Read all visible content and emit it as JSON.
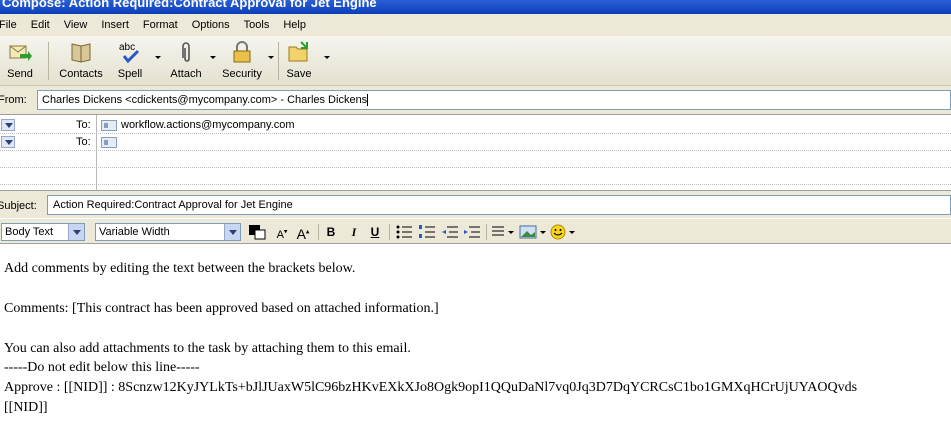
{
  "window": {
    "title": "Compose: Action Required:Contract Approval for Jet Engine"
  },
  "menu": [
    "File",
    "Edit",
    "View",
    "Insert",
    "Format",
    "Options",
    "Tools",
    "Help"
  ],
  "toolbar": {
    "send": "Send",
    "contacts": "Contacts",
    "spell": "Spell",
    "spell_icon_text": "abc",
    "attach": "Attach",
    "security": "Security",
    "save": "Save"
  },
  "header": {
    "from_label": "From:",
    "from_value": "Charles Dickens <cdickents@mycompany.com>  - Charles Dickens",
    "to_label": "To:",
    "recipients": [
      "workflow.actions@mycompany.com",
      ""
    ],
    "subject_label": "Subject:",
    "subject_value": "Action Required:Contract Approval for Jet Engine"
  },
  "format": {
    "paragraph_style": "Body Text",
    "font": "Variable Width",
    "bold": "B",
    "italic": "I",
    "underline": "U",
    "text_color": "#000000"
  },
  "body": {
    "line1": "Add comments by editing the text between the brackets below.",
    "line2": "Comments: [This contract has been approved based on attached information.]",
    "line3": "You can also add attachments to the task by attaching them to this email.",
    "line4": "-----Do not edit below this line-----",
    "line5": "Approve : [[NID]] : 8Scnzw12KyJYLkTs+bJlJUaxW5lC96bzHKvEXkXJo8Ogk9opI1QQuDaNl7vq0Jq3D7DqYCRCsC1bo1GMXqHCrUjUYAOQvds",
    "line6": "[[NID]]"
  }
}
